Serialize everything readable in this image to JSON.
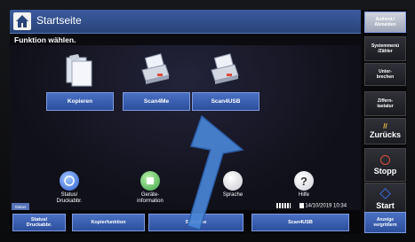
{
  "header": {
    "title": "Startseite"
  },
  "subtitle": "Funktion wählen.",
  "functions": [
    {
      "label": "Kopieren",
      "icon": "copier-icon"
    },
    {
      "label": "Scan4Me",
      "icon": "scanner-icon"
    },
    {
      "label": "Scan4USB",
      "icon": "scanner-usb-icon"
    }
  ],
  "shortcuts": {
    "status": "Status/\nDruckabbr.",
    "geraete": "Geräte-\ninformation",
    "sprache": "Sprache",
    "hilfe": "Hilfe"
  },
  "statusbar": {
    "date": "14/10/2019",
    "time": "10:34"
  },
  "bottom": {
    "status_tag": "Status",
    "status_button": "Status/\nDruckabbr.",
    "kopierfunktion": "Kopierfunktion",
    "scan4me": "Scan4Me",
    "scan4usb": "Scan4USB",
    "anzeige": "Anzeige\nvergrößern"
  },
  "side": {
    "authent": "Authent./\nAbmelden",
    "systemmenu": "Systemmenü\n/Zähler",
    "unterbrechen": "Unter-\nbrechen",
    "ziffern": "Ziffern-\ntastatur",
    "zurueck": "Zurücks",
    "stopp": "Stopp",
    "start": "Start"
  },
  "colors": {
    "accent": "#3a5eb2",
    "stop_red": "#e04a3a",
    "start_blue": "#3a68d8",
    "reset_yellow": "#f0c040",
    "arrow_blue": "#4a86d6"
  }
}
